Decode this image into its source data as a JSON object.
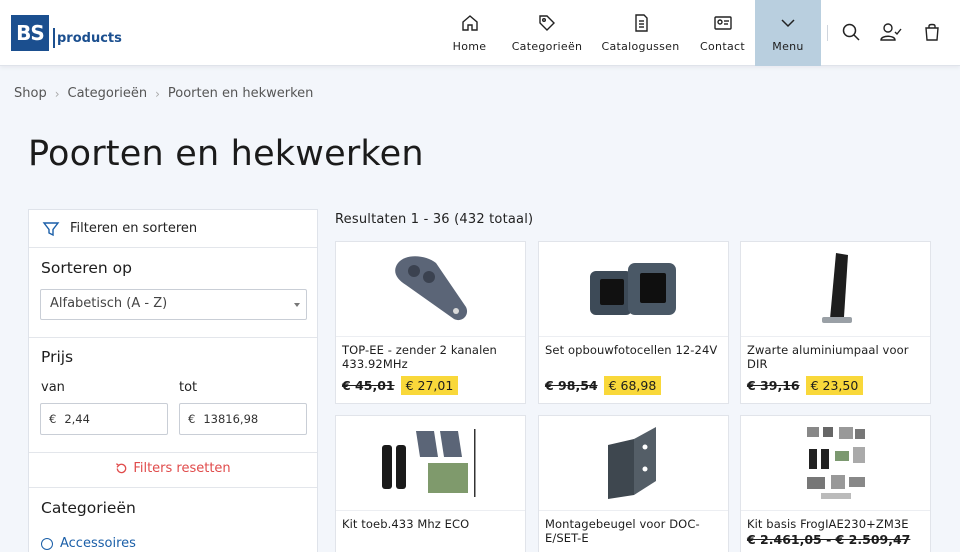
{
  "brand": {
    "mark": "BS",
    "name": "products"
  },
  "nav": [
    {
      "label": "Home",
      "icon": "home-icon"
    },
    {
      "label": "Categorieën",
      "icon": "tag-icon"
    },
    {
      "label": "Catalogussen",
      "icon": "catalog-icon"
    },
    {
      "label": "Contact",
      "icon": "contact-card-icon"
    },
    {
      "label": "Menu",
      "icon": "chevron-down-icon"
    }
  ],
  "header_icons": [
    "search-icon",
    "user-check-icon",
    "shopping-bag-icon"
  ],
  "breadcrumb": [
    "Shop",
    "Categorieën",
    "Poorten en hekwerken"
  ],
  "page_title": "Poorten en hekwerken",
  "sidebar": {
    "filter_title": "Filteren en sorteren",
    "sort_title": "Sorteren op",
    "sort_value": "Alfabetisch (A - Z)",
    "price_title": "Prijs",
    "price_from_label": "van",
    "price_to_label": "tot",
    "currency": "€",
    "price_from": "2,44",
    "price_to": "13816,98",
    "reset_label": "Filters resetten",
    "categories_title": "Categorieën",
    "categories": [
      "Accessoires"
    ]
  },
  "results": {
    "summary": "Resultaten 1 - 36 (432 totaal)"
  },
  "products": [
    {
      "name": "TOP-EE - zender 2 kanalen 433.92MHz",
      "old_price": "€ 45,01",
      "new_price": "€ 27,01"
    },
    {
      "name": "Set opbouwfotocellen 12-24V",
      "old_price": "€ 98,54",
      "new_price": "€ 68,98"
    },
    {
      "name": "Zwarte aluminiumpaal voor DIR",
      "old_price": "€ 39,16",
      "new_price": "€ 23,50"
    },
    {
      "name": "Kit toeb.433 Mhz ECO",
      "old_price": "",
      "new_price": ""
    },
    {
      "name": "Montagebeugel voor DOC-E/SET-E",
      "old_price": "",
      "new_price": ""
    },
    {
      "name": "Kit basis FrogIAE230+ZM3E",
      "old_price": "€ 2.461,05 - € 2.509,47",
      "new_price": ""
    }
  ],
  "colors": {
    "accent": "#1b4f8f",
    "menu_bg": "#b9cfdf",
    "price_highlight": "#f9d83a",
    "reset": "#e04b4b",
    "link": "#1b5fa8"
  }
}
